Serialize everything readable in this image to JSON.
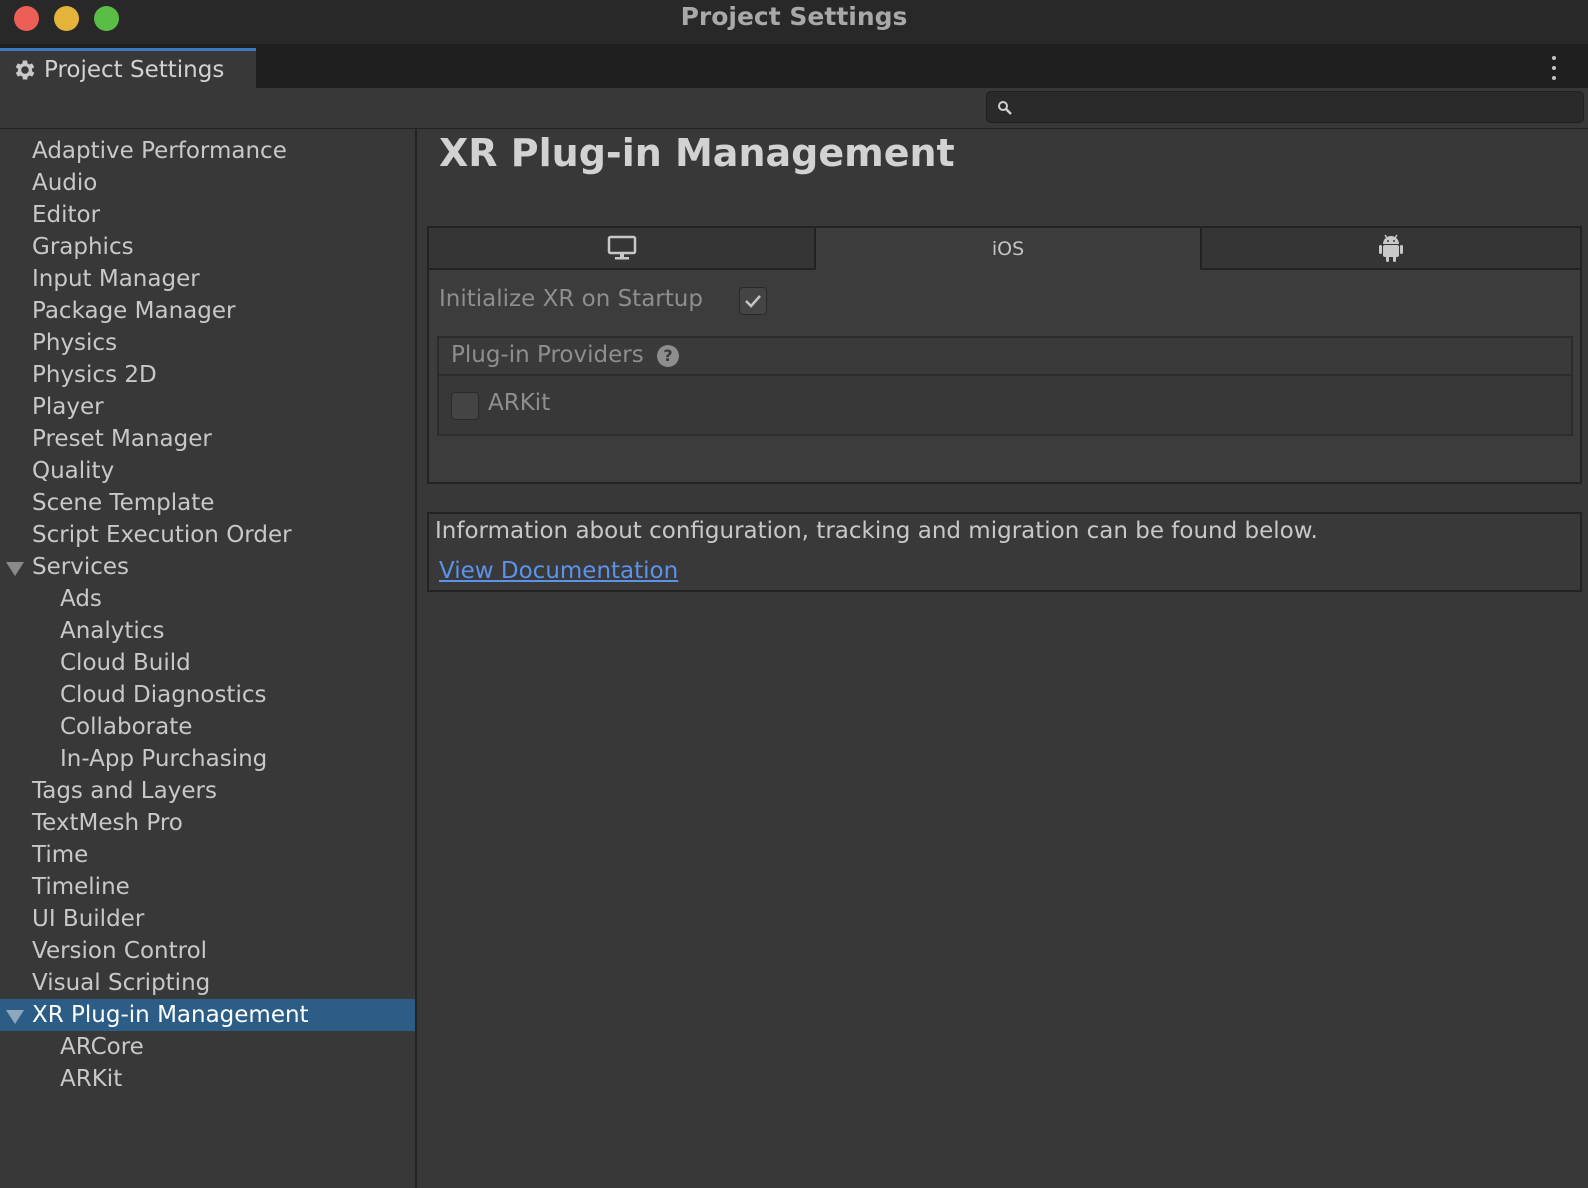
{
  "window": {
    "title": "Project Settings",
    "tab_label": "Project Settings"
  },
  "search": {
    "placeholder": "",
    "value": ""
  },
  "sidebar": {
    "items": [
      {
        "label": "Adaptive Performance"
      },
      {
        "label": "Audio"
      },
      {
        "label": "Editor"
      },
      {
        "label": "Graphics"
      },
      {
        "label": "Input Manager"
      },
      {
        "label": "Package Manager"
      },
      {
        "label": "Physics"
      },
      {
        "label": "Physics 2D"
      },
      {
        "label": "Player"
      },
      {
        "label": "Preset Manager"
      },
      {
        "label": "Quality"
      },
      {
        "label": "Scene Template"
      },
      {
        "label": "Script Execution Order"
      },
      {
        "label": "Services",
        "expanded": true
      },
      {
        "label": "Ads"
      },
      {
        "label": "Analytics"
      },
      {
        "label": "Cloud Build"
      },
      {
        "label": "Cloud Diagnostics"
      },
      {
        "label": "Collaborate"
      },
      {
        "label": "In-App Purchasing"
      },
      {
        "label": "Tags and Layers"
      },
      {
        "label": "TextMesh Pro"
      },
      {
        "label": "Time"
      },
      {
        "label": "Timeline"
      },
      {
        "label": "UI Builder"
      },
      {
        "label": "Version Control"
      },
      {
        "label": "Visual Scripting"
      },
      {
        "label": "XR Plug-in Management",
        "expanded": true,
        "selected": true
      },
      {
        "label": "ARCore"
      },
      {
        "label": "ARKit"
      }
    ]
  },
  "main": {
    "title": "XR Plug-in Management",
    "platform_tabs": [
      {
        "icon": "desktop-icon",
        "label": ""
      },
      {
        "icon": "",
        "label": "iOS",
        "active": true
      },
      {
        "icon": "android-icon",
        "label": ""
      }
    ],
    "initialize_label": "Initialize XR on Startup",
    "initialize_checked": true,
    "providers_label": "Plug-in Providers",
    "help_glyph": "?",
    "providers": [
      {
        "label": "ARKit",
        "checked": false
      }
    ],
    "info_text": "Information about configuration, tracking and migration can be found below.",
    "doc_link": "View Documentation"
  },
  "colors": {
    "selection": "#2c5d87",
    "link": "#5c93ea",
    "tab_accent": "#3a78c3",
    "close": "#ec5f57",
    "minimize": "#e3b33a",
    "maximize": "#59bd46"
  }
}
